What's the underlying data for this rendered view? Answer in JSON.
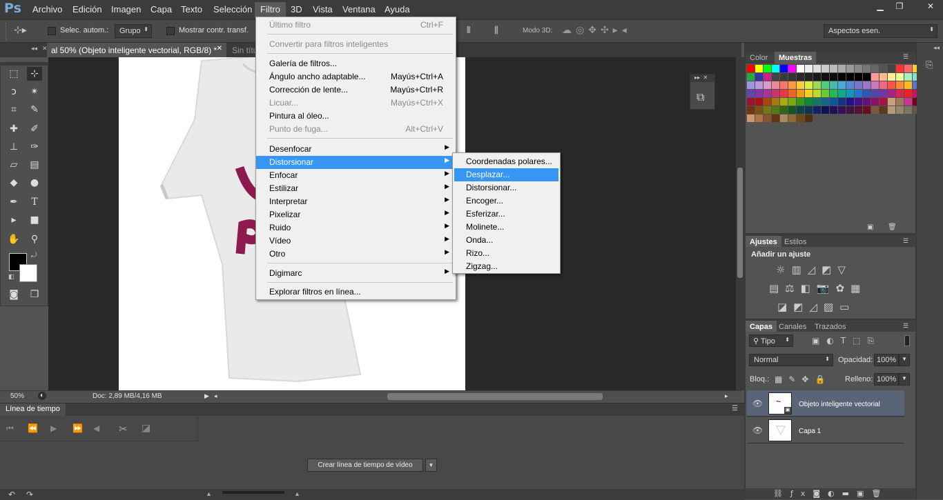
{
  "app": {
    "logo": "Ps"
  },
  "menubar": {
    "items": [
      "Archivo",
      "Edición",
      "Imagen",
      "Capa",
      "Texto",
      "Selección",
      "Filtro",
      "3D",
      "Vista",
      "Ventana",
      "Ayuda"
    ]
  },
  "options": {
    "auto_select_label": "Selec. autom.:",
    "group_value": "Grupo",
    "show_transform_label": "Mostrar contr. transf.",
    "mode3d_label": "Modo 3D:",
    "workspace_value": "Aspectos esen."
  },
  "document": {
    "tab_active": "al 50% (Objeto inteligente vectorial, RGB/8) *",
    "tab_other": "Sin títu",
    "zoom": "50%",
    "doc_info": "Doc: 2,89 MB/4,16 MB"
  },
  "filter_menu": {
    "last_filter": "Último filtro",
    "last_filter_sc": "Ctrl+F",
    "convert_smart": "Convertir para filtros inteligentes",
    "gallery": "Galería de filtros...",
    "wide_angle": "Ángulo ancho adaptable...",
    "wide_angle_sc": "Mayús+Ctrl+A",
    "lens": "Corrección de lente...",
    "lens_sc": "Mayús+Ctrl+R",
    "liquify": "Licuar...",
    "liquify_sc": "Mayús+Ctrl+X",
    "oil": "Pintura al óleo...",
    "vanish": "Punto de fuga...",
    "vanish_sc": "Alt+Ctrl+V",
    "blur": "Desenfocar",
    "distort": "Distorsionar",
    "sharpen": "Enfocar",
    "stylize": "Estilizar",
    "render": "Interpretar",
    "pixelate": "Pixelizar",
    "noise": "Ruido",
    "video": "Vídeo",
    "other": "Otro",
    "digimarc": "Digimarc",
    "browse": "Explorar filtros en línea..."
  },
  "distort_submenu": {
    "items": [
      "Coordenadas polares...",
      "Desplazar...",
      "Distorsionar...",
      "Encoger...",
      "Esferizar...",
      "Molinete...",
      "Onda...",
      "Rizo...",
      "Zigzag..."
    ]
  },
  "timeline": {
    "tab": "Línea de tiempo",
    "create_button": "Crear línea de tiempo de vídeo"
  },
  "swatches_panel": {
    "tab_color": "Color",
    "tab_swatches": "Muestras"
  },
  "adjustments_panel": {
    "tab_adjust": "Ajustes",
    "tab_styles": "Estilos",
    "heading": "Añadir un ajuste"
  },
  "layers_panel": {
    "tab_layers": "Capas",
    "tab_channels": "Canales",
    "tab_paths": "Trazados",
    "filter_kind": "Tipo",
    "blend_mode": "Normal",
    "opacity_label": "Opacidad:",
    "opacity_value": "100%",
    "lock_label": "Bloq.:",
    "fill_label": "Relleno:",
    "fill_value": "100%",
    "layers": [
      "Objeto inteligente vectorial",
      "Capa 1"
    ]
  },
  "colors": {
    "highlight": "#3796f4",
    "menu_bg": "#f0f0f0"
  },
  "swatch_colors": [
    "#ff0000",
    "#ffff00",
    "#00ff00",
    "#00ffff",
    "#0000ff",
    "#ff00ff",
    "#ffffff",
    "#eeeeee",
    "#dddddd",
    "#cccccc",
    "#bbbbbb",
    "#aaaaaa",
    "#999999",
    "#888888",
    "#777777",
    "#666666",
    "#555555",
    "#444444",
    "#ff3333",
    "#ff6666",
    "#ffcc33",
    "#ccff33",
    "#22aa44",
    "#3333aa",
    "#cc2288",
    "#444444",
    "#3a3a3a",
    "#333333",
    "#2a2a2a",
    "#222222",
    "#1a1a1a",
    "#111111",
    "#0a0a0a",
    "#050505",
    "#000000",
    "#000000",
    "#000000",
    "#ff9999",
    "#ffbb88",
    "#ffee99",
    "#eeff99",
    "#aaeebb",
    "#88ddcc",
    "#99ccee",
    "#9999dd",
    "#bb99dd",
    "#dd99cc",
    "#ee8899",
    "#ff7766",
    "#ff9944",
    "#ffcc44",
    "#ddee44",
    "#99dd55",
    "#55cc77",
    "#44bbaa",
    "#44aadd",
    "#5588dd",
    "#7777cc",
    "#9977cc",
    "#cc77bb",
    "#ee6688",
    "#ff5544",
    "#ff8833",
    "#ffbb22",
    "#5577cc",
    "#4455bb",
    "#6644aa",
    "#8833aa",
    "#aa3399",
    "#cc3366",
    "#ee3344",
    "#ee6622",
    "#f09a1a",
    "#f0d020",
    "#bbdd22",
    "#66cc33",
    "#22bb55",
    "#11aa88",
    "#1199bb",
    "#2277cc",
    "#3355bb",
    "#5544aa",
    "#7733aa",
    "#aa2288",
    "#dd2255",
    "#ee2222",
    "#cc1166",
    "#991155",
    "#991133",
    "#aa1111",
    "#aa4411",
    "#aa7711",
    "#aaaa11",
    "#77aa11",
    "#33991a",
    "#118833",
    "#117766",
    "#116688",
    "#115599",
    "#113388",
    "#221188",
    "#441188",
    "#661177",
    "#881166",
    "#aa1144",
    "#c8a07a",
    "#a0785a",
    "#cc3399",
    "#770022",
    "#771111",
    "#773311",
    "#775511",
    "#777711",
    "#557711",
    "#336611",
    "#115522",
    "#114444",
    "#113355",
    "#112266",
    "#111155",
    "#221155",
    "#331155",
    "#441144",
    "#551133",
    "#661122",
    "#7a5a3a",
    "#5a3a1a",
    "#bb9977",
    "#998866",
    "#777766",
    "#665544",
    "#554433",
    "#cc9966",
    "#aa7744",
    "#885533",
    "#663311",
    "#b08860",
    "#906838",
    "#704818",
    "#503010"
  ]
}
